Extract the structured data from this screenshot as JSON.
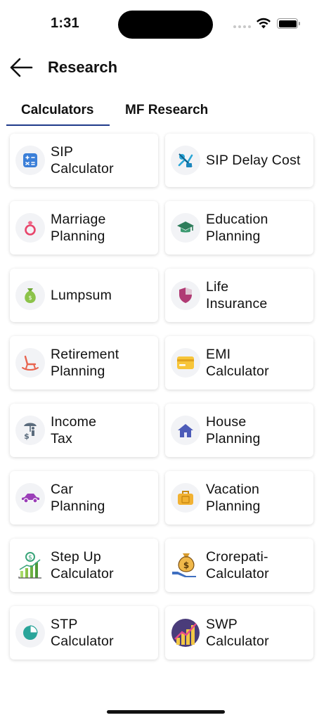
{
  "status": {
    "time": "1:31"
  },
  "nav": {
    "title": "Research"
  },
  "tabs": [
    {
      "label": "Calculators"
    },
    {
      "label": "MF Research"
    }
  ],
  "cards": [
    {
      "label": "SIP\nCalculator",
      "icon": "calculator-icon"
    },
    {
      "label": "SIP Delay Cost",
      "icon": "delay-cost-icon"
    },
    {
      "label": "Marriage\nPlanning",
      "icon": "ring-icon"
    },
    {
      "label": "Education\nPlanning",
      "icon": "graduation-cap-icon"
    },
    {
      "label": "Lumpsum",
      "icon": "money-bag-icon"
    },
    {
      "label": "Life\nInsurance",
      "icon": "shield-icon"
    },
    {
      "label": "Retirement\nPlanning",
      "icon": "rocking-chair-icon"
    },
    {
      "label": "EMI\nCalculator",
      "icon": "card-icon"
    },
    {
      "label": "Income\nTax",
      "icon": "tax-umbrella-icon"
    },
    {
      "label": "House\nPlanning",
      "icon": "house-icon"
    },
    {
      "label": "Car\nPlanning",
      "icon": "car-icon"
    },
    {
      "label": "Vacation\nPlanning",
      "icon": "suitcase-icon"
    },
    {
      "label": "Step Up\nCalculator",
      "icon": "growth-chart-icon"
    },
    {
      "label": "Crorepati-\nCalculator",
      "icon": "money-bag-hand-icon"
    },
    {
      "label": "STP\nCalculator",
      "icon": "pie-chart-icon"
    },
    {
      "label": "SWP\nCalculator",
      "icon": "swp-chart-icon"
    }
  ],
  "colors": {
    "tab_underline": "#1f3a8a",
    "icon_bg": "#f2f3f6"
  }
}
